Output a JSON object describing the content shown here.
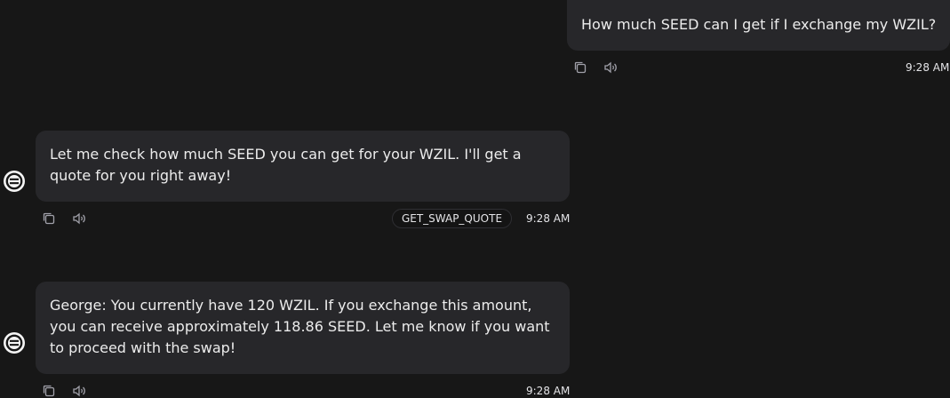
{
  "messages": [
    {
      "role": "user",
      "text": "How much SEED can I get if I exchange my WZIL?",
      "time": "9:28 AM",
      "actions": [
        "copy-icon",
        "speaker-icon"
      ]
    },
    {
      "role": "agent",
      "text": "Let me check how much SEED you can get for your WZIL. I'll get a quote for you right away!",
      "action_tag": "GET_SWAP_QUOTE",
      "time": "9:28 AM",
      "actions": [
        "copy-icon",
        "speaker-icon"
      ]
    },
    {
      "role": "agent",
      "text": "George: You currently have 120 WZIL. If you exchange this amount, you can receive approximately 118.86 SEED. Let me know if you want to proceed with the swap!",
      "time": "9:28 AM",
      "actions": [
        "copy-icon",
        "speaker-icon"
      ]
    }
  ],
  "colors": {
    "background": "#171717",
    "bubble": "#27272a",
    "text": "#ececec",
    "icon": "#a1a1aa"
  }
}
